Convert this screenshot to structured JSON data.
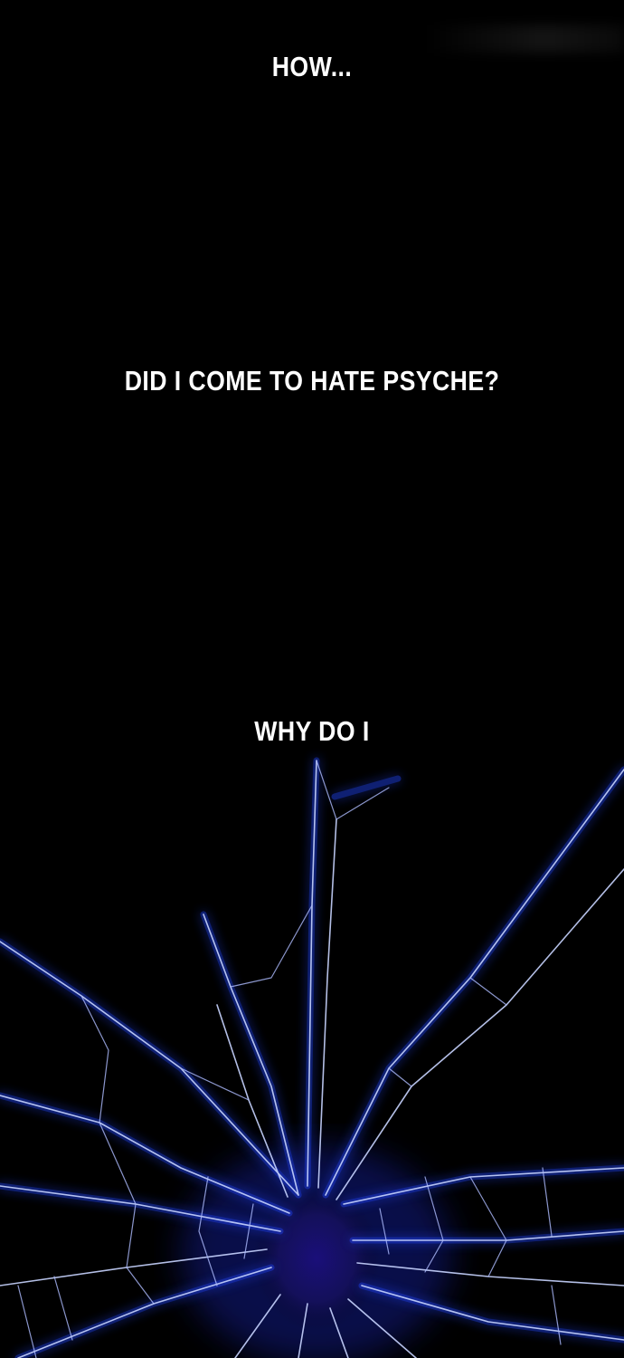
{
  "panel": {
    "captions": [
      {
        "text": "HOW..."
      },
      {
        "text": "DID I COME TO HATE PSYCHE?"
      },
      {
        "text": "WHY DO I"
      }
    ]
  },
  "colors": {
    "background": "#000000",
    "text": "#ffffff",
    "crack_glow": "#1f3dff",
    "crack_line": "#c8d4ff",
    "impact_center": "#1a1470"
  },
  "art": {
    "subject": "shattered-glass-impact"
  }
}
